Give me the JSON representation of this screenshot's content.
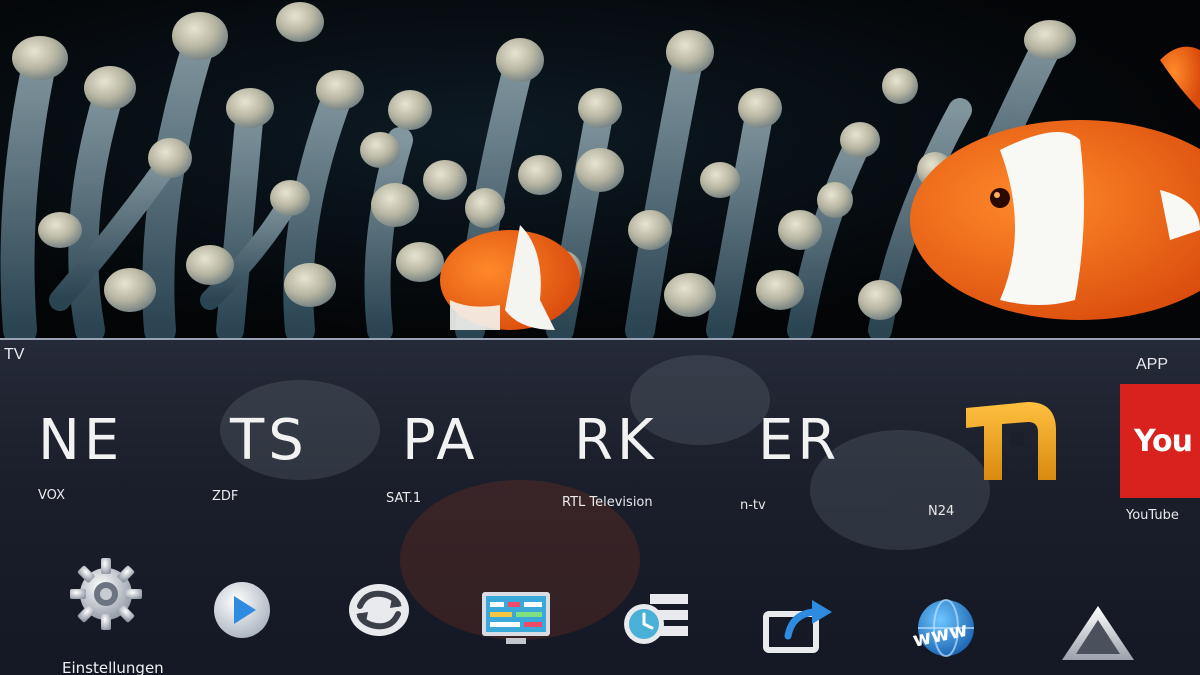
{
  "sections": {
    "tv_label": "TV",
    "app_label": "APP"
  },
  "channels": [
    {
      "tile_text": "NE",
      "name": "VOX"
    },
    {
      "tile_text": "TS",
      "name": "ZDF"
    },
    {
      "tile_text": "PA",
      "name": "SAT.1"
    },
    {
      "tile_text": "RK",
      "name": "RTL Television"
    },
    {
      "tile_text": "ER",
      "name": "n-tv"
    },
    {
      "tile_text": "",
      "name": "N24"
    }
  ],
  "apps": [
    {
      "name": "YouTube",
      "tile_text": "You"
    }
  ],
  "bottom_bar": {
    "settings_label": "Einstellungen",
    "icons": [
      "gear-icon",
      "play-icon",
      "sync-icon",
      "tv-guide-icon",
      "timer-list-icon",
      "share-screen-icon",
      "www-browser-icon",
      "up-arrow-icon"
    ]
  },
  "colors": {
    "panel": "#1f2330",
    "clownfish_orange": "#ff6a1a",
    "youtube_red": "#d9211e",
    "n24_orange": "#f0a020"
  }
}
